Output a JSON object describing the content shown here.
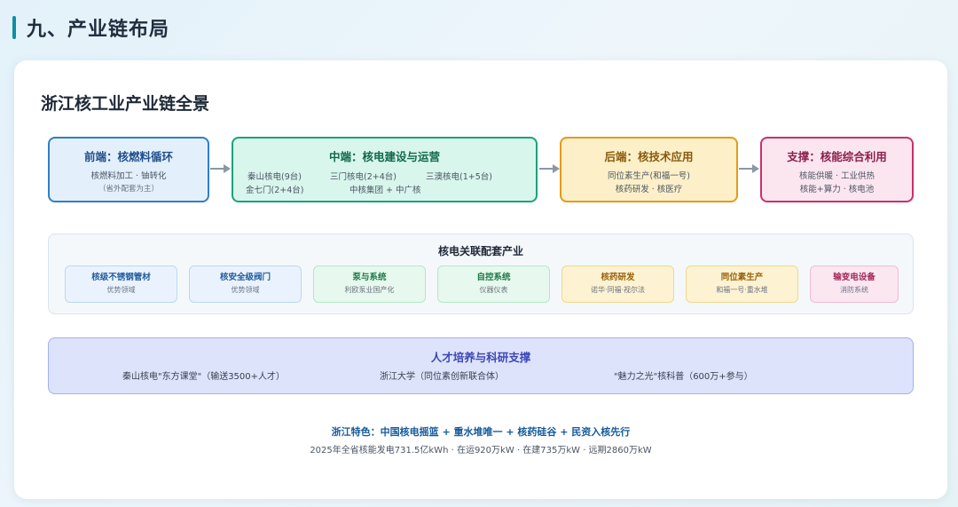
{
  "page": {
    "heading": "九、产业链布局"
  },
  "card": {
    "title": "浙江核工业产业链全景"
  },
  "stages": {
    "front": {
      "title": "前端：核燃料循环",
      "line1": "核燃料加工 · 铀转化",
      "note": "（省外配套为主）"
    },
    "middle": {
      "title": "中端：核电建设与运营",
      "items": [
        "秦山核电(9台)",
        "三门核电(2+4台)",
        "三澳核电(1+5台)",
        "金七门(2+4台)",
        "中核集团 + 中广核"
      ]
    },
    "back": {
      "title": "后端：核技术应用",
      "line1": "同位素生产(和福一号)",
      "line2": "核药研发 · 核医疗"
    },
    "support": {
      "title": "支撑：核能综合利用",
      "line1": "核能供暖 · 工业供热",
      "line2": "核能+算力 · 核电池"
    }
  },
  "supporting_industries": {
    "title": "核电关联配套产业",
    "items": [
      {
        "title": "核级不锈钢管材",
        "subtitle": "优势领域",
        "color": "blue"
      },
      {
        "title": "核安全级阀门",
        "subtitle": "优势领域",
        "color": "blue"
      },
      {
        "title": "泵与系统",
        "subtitle": "利欧泵业国产化",
        "color": "green"
      },
      {
        "title": "自控系统",
        "subtitle": "仪器仪表",
        "color": "green"
      },
      {
        "title": "核药研发",
        "subtitle": "诺华·同福·视尔法",
        "color": "yellow"
      },
      {
        "title": "同位素生产",
        "subtitle": "和福一号·重水堆",
        "color": "yellow"
      },
      {
        "title": "输变电设备",
        "subtitle": "消防系统",
        "color": "pink"
      }
    ]
  },
  "talent": {
    "title": "人才培养与科研支撑",
    "items": [
      "秦山核电\"东方课堂\"（输送3500+人才）",
      "浙江大学（同位素创新联合体）",
      "\"魅力之光\"核科普（600万+参与）"
    ]
  },
  "footer": {
    "feature": "浙江特色：中国核电摇篮 + 重水堆唯一 + 核药硅谷 + 民资入核先行",
    "stats": "2025年全省核能发电731.5亿kWh · 在运920万kW · 在建735万kW · 远期2860万kW"
  },
  "colors": {
    "accent": "#0e8fa3",
    "front": "#2f7fc9",
    "middle": "#1aa37a",
    "back": "#e39a1b",
    "support": "#c9306d",
    "talent": "#a3b0ee",
    "arrow": "#8a97a6"
  },
  "icons": {
    "flow_arrow": "right-arrow-icon"
  }
}
